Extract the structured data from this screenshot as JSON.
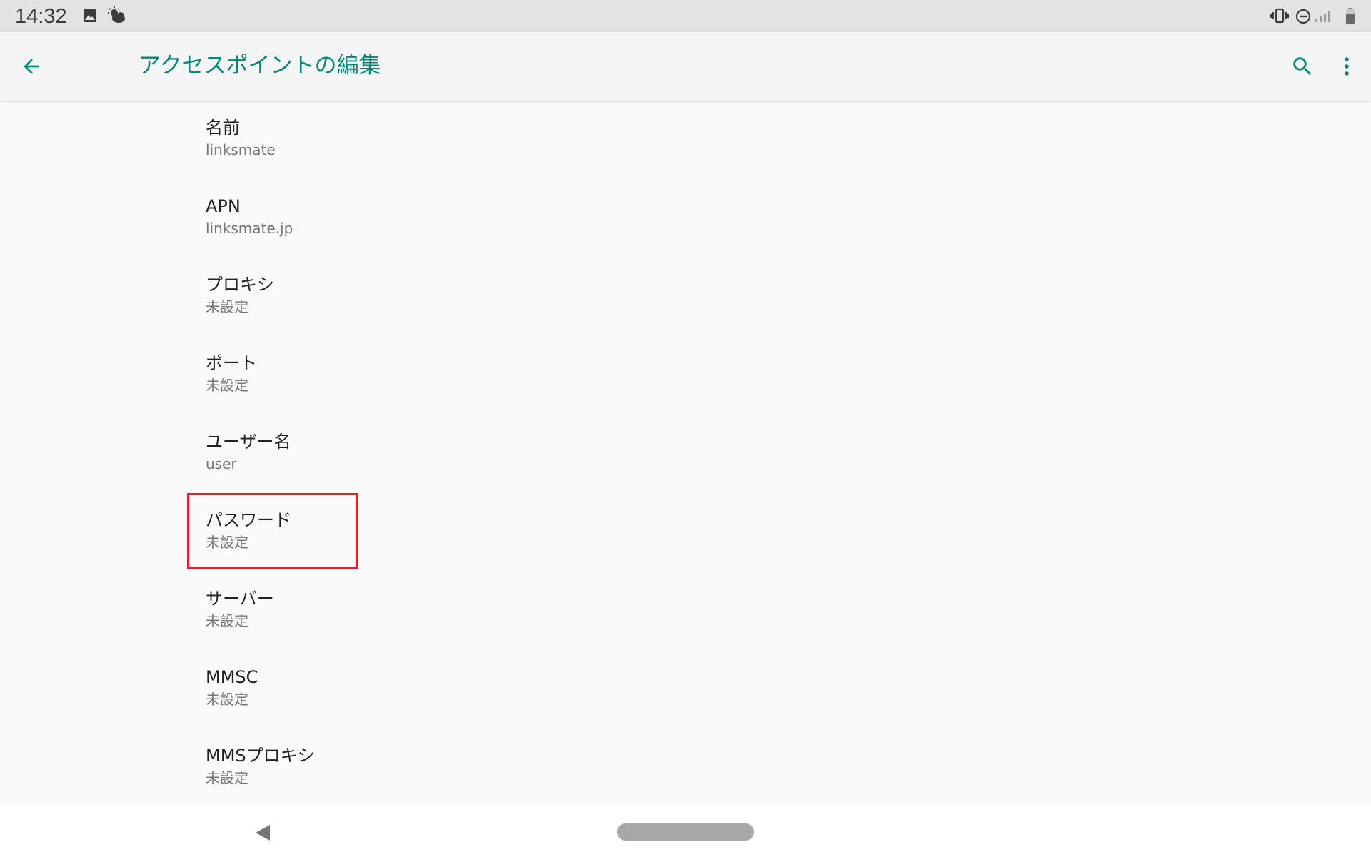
{
  "status_bar": {
    "time": "14:32",
    "notification_icons": [
      "image-icon",
      "weather-icon"
    ],
    "system_icons": [
      "vibrate-icon",
      "do-not-disturb-icon",
      "signal-icon",
      "battery-icon"
    ]
  },
  "app_bar": {
    "title": "アクセスポイントの編集",
    "back_icon": "arrow-back-icon",
    "search_icon": "search-icon",
    "more_icon": "more-vert-icon",
    "accent_color": "#00897b"
  },
  "preferences": [
    {
      "title": "名前",
      "summary": "linksmate"
    },
    {
      "title": "APN",
      "summary": "linksmate.jp"
    },
    {
      "title": "プロキシ",
      "summary": "未設定"
    },
    {
      "title": "ポート",
      "summary": "未設定"
    },
    {
      "title": "ユーザー名",
      "summary": "user"
    },
    {
      "title": "パスワード",
      "summary": "未設定",
      "highlighted": true
    },
    {
      "title": "サーバー",
      "summary": "未設定"
    },
    {
      "title": "MMSC",
      "summary": "未設定"
    },
    {
      "title": "MMSプロキシ",
      "summary": "未設定"
    }
  ],
  "highlight_color": "#e0202a",
  "nav_bar": {
    "back_icon": "nav-back-icon",
    "home_icon": "home-pill"
  }
}
